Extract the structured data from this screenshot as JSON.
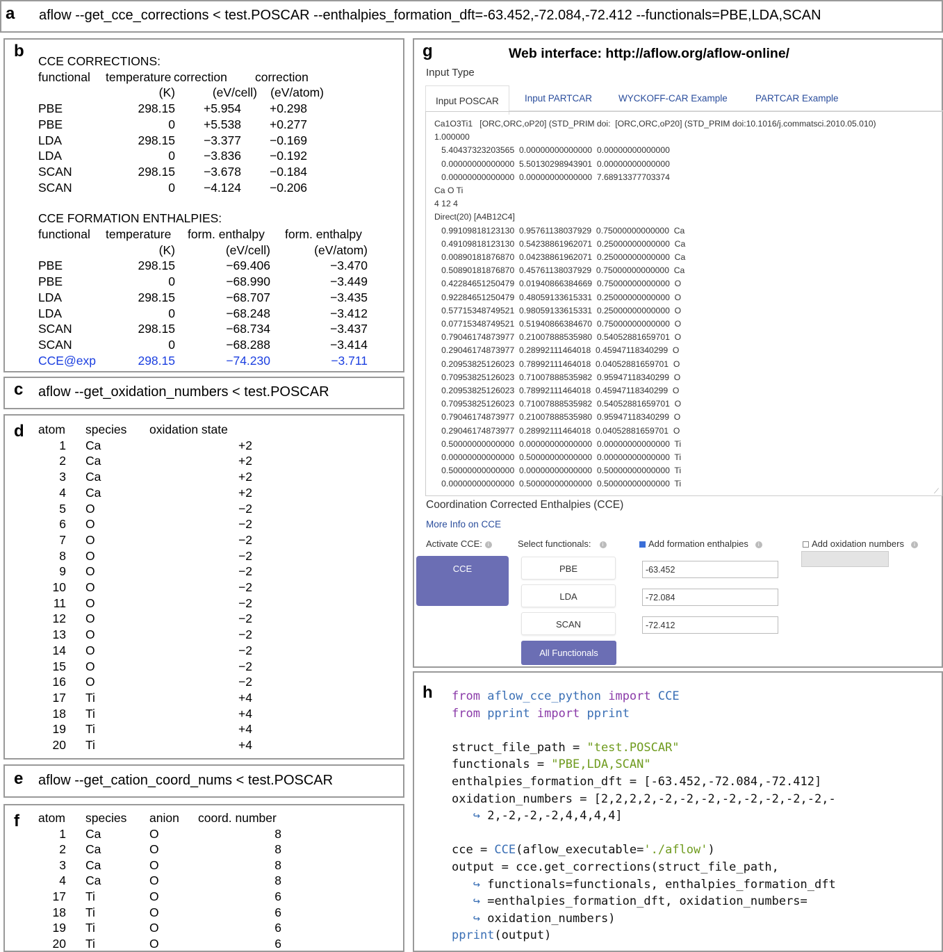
{
  "panels": {
    "a": {
      "label": "a",
      "command": "aflow --get_cce_corrections < test.POSCAR  --enthalpies_formation_dft=-63.452,-72.084,-72.412 --functionals=PBE,LDA,SCAN"
    },
    "b": {
      "label": "b",
      "corrections_title": "CCE CORRECTIONS:",
      "corrections_headers": [
        "functional",
        "temperature",
        "correction",
        "correction"
      ],
      "corrections_units": [
        "",
        "(K)",
        "(eV/cell)",
        "(eV/atom)"
      ],
      "corrections_rows": [
        [
          "PBE",
          "298.15",
          "+5.954",
          "+0.298"
        ],
        [
          "PBE",
          "0",
          "+5.538",
          "+0.277"
        ],
        [
          "LDA",
          "298.15",
          "−3.377",
          "−0.169"
        ],
        [
          "LDA",
          "0",
          "−3.836",
          "−0.192"
        ],
        [
          "SCAN",
          "298.15",
          "−3.678",
          "−0.184"
        ],
        [
          "SCAN",
          "0",
          "−4.124",
          "−0.206"
        ]
      ],
      "enthalpies_title": "CCE FORMATION ENTHALPIES:",
      "enthalpies_headers": [
        "functional",
        "temperature",
        "form. enthalpy",
        "form. enthalpy"
      ],
      "enthalpies_units": [
        "",
        "(K)",
        "(eV/cell)",
        "(eV/atom)"
      ],
      "enthalpies_rows": [
        [
          "PBE",
          "298.15",
          "−69.406",
          "−3.470"
        ],
        [
          "PBE",
          "0",
          "−68.990",
          "−3.449"
        ],
        [
          "LDA",
          "298.15",
          "−68.707",
          "−3.435"
        ],
        [
          "LDA",
          "0",
          "−68.248",
          "−3.412"
        ],
        [
          "SCAN",
          "298.15",
          "−68.734",
          "−3.437"
        ],
        [
          "SCAN",
          "0",
          "−68.288",
          "−3.414"
        ],
        [
          "CCE@exp",
          "298.15",
          "−74.230",
          "−3.711"
        ]
      ],
      "highlight_color": "#1b3fe0"
    },
    "c": {
      "label": "c",
      "command": "aflow --get_oxidation_numbers < test.POSCAR"
    },
    "d": {
      "label": "d",
      "headers": [
        "atom",
        "species",
        "oxidation state"
      ],
      "rows": [
        [
          "1",
          "Ca",
          "+2"
        ],
        [
          "2",
          "Ca",
          "+2"
        ],
        [
          "3",
          "Ca",
          "+2"
        ],
        [
          "4",
          "Ca",
          "+2"
        ],
        [
          "5",
          "O",
          "−2"
        ],
        [
          "6",
          "O",
          "−2"
        ],
        [
          "7",
          "O",
          "−2"
        ],
        [
          "8",
          "O",
          "−2"
        ],
        [
          "9",
          "O",
          "−2"
        ],
        [
          "10",
          "O",
          "−2"
        ],
        [
          "11",
          "O",
          "−2"
        ],
        [
          "12",
          "O",
          "−2"
        ],
        [
          "13",
          "O",
          "−2"
        ],
        [
          "14",
          "O",
          "−2"
        ],
        [
          "15",
          "O",
          "−2"
        ],
        [
          "16",
          "O",
          "−2"
        ],
        [
          "17",
          "Ti",
          "+4"
        ],
        [
          "18",
          "Ti",
          "+4"
        ],
        [
          "19",
          "Ti",
          "+4"
        ],
        [
          "20",
          "Ti",
          "+4"
        ]
      ]
    },
    "e": {
      "label": "e",
      "command": "aflow --get_cation_coord_nums < test.POSCAR"
    },
    "f": {
      "label": "f",
      "headers": [
        "atom",
        "species",
        "anion",
        "coord. number"
      ],
      "rows": [
        [
          "1",
          "Ca",
          "O",
          "8"
        ],
        [
          "2",
          "Ca",
          "O",
          "8"
        ],
        [
          "3",
          "Ca",
          "O",
          "8"
        ],
        [
          "4",
          "Ca",
          "O",
          "8"
        ],
        [
          "17",
          "Ti",
          "O",
          "6"
        ],
        [
          "18",
          "Ti",
          "O",
          "6"
        ],
        [
          "19",
          "Ti",
          "O",
          "6"
        ],
        [
          "20",
          "Ti",
          "O",
          "6"
        ]
      ]
    },
    "g": {
      "label": "g",
      "title": "Web interface: http://aflow.org/aflow-online/",
      "input_type_label": "Input Type",
      "tabs": [
        "Input POSCAR",
        "Input PARTCAR",
        "WYCKOFF-CAR Example",
        "PARTCAR Example"
      ],
      "poscar_lines": [
        "Ca1O3Ti1   [ORC,ORC,oP20] (STD_PRIM doi:  [ORC,ORC,oP20] (STD_PRIM doi:10.1016/j.commatsci.2010.05.010)",
        "1.000000",
        "   5.40437323203565  0.00000000000000  0.00000000000000",
        "   0.00000000000000  5.50130298943901  0.00000000000000",
        "   0.00000000000000  0.00000000000000  7.68913377703374",
        "Ca O Ti",
        "4 12 4",
        "Direct(20) [A4B12C4]",
        "   0.99109818123130  0.95761138037929  0.75000000000000  Ca",
        "   0.49109818123130  0.54238861962071  0.25000000000000  Ca",
        "   0.00890181876870  0.04238861962071  0.25000000000000  Ca",
        "   0.50890181876870  0.45761138037929  0.75000000000000  Ca",
        "   0.42284651250479  0.01940866384669  0.75000000000000  O",
        "   0.92284651250479  0.48059133615331  0.25000000000000  O",
        "   0.57715348749521  0.98059133615331  0.25000000000000  O",
        "   0.07715348749521  0.51940866384670  0.75000000000000  O",
        "   0.79046174873977  0.21007888535980  0.54052881659701  O",
        "   0.29046174873977  0.28992111464018  0.45947118340299  O",
        "   0.20953825126023  0.78992111464018  0.04052881659701  O",
        "   0.70953825126023  0.71007888535982  0.95947118340299  O",
        "   0.20953825126023  0.78992111464018  0.45947118340299  O",
        "   0.70953825126023  0.71007888535982  0.54052881659701  O",
        "   0.79046174873977  0.21007888535980  0.95947118340299  O",
        "   0.29046174873977  0.28992111464018  0.04052881659701  O",
        "   0.50000000000000  0.00000000000000  0.00000000000000  Ti",
        "   0.00000000000000  0.50000000000000  0.00000000000000  Ti",
        "   0.50000000000000  0.00000000000000  0.50000000000000  Ti",
        "   0.00000000000000  0.50000000000000  0.50000000000000  Ti"
      ],
      "cce_heading": "Coordination Corrected Enthalpies (CCE)",
      "more_info_link": "More Info on CCE",
      "activate_label": "Activate CCE:",
      "select_functionals_label": "Select functionals:",
      "add_formation_label": "Add formation enthalpies",
      "add_oxidation_label": "Add oxidation numbers",
      "add_formation_checked": true,
      "add_oxidation_checked": false,
      "cce_button": "CCE",
      "functional_buttons": [
        "PBE",
        "LDA",
        "SCAN"
      ],
      "enthalpy_inputs": [
        "-63.452",
        "-72.084",
        "-72.412"
      ],
      "all_functionals_button": "All Functionals",
      "accent_color": "#6b6eb4",
      "link_color": "#2a4d9c"
    },
    "h": {
      "label": "h",
      "code_lines": [
        [
          [
            "kw",
            "from"
          ],
          [
            "t",
            " "
          ],
          [
            "mod",
            "aflow_cce_python"
          ],
          [
            "t",
            " "
          ],
          [
            "kw",
            "import"
          ],
          [
            "t",
            " "
          ],
          [
            "mod",
            "CCE"
          ]
        ],
        [
          [
            "kw",
            "from"
          ],
          [
            "t",
            " "
          ],
          [
            "mod",
            "pprint"
          ],
          [
            "t",
            " "
          ],
          [
            "kw",
            "import"
          ],
          [
            "t",
            " "
          ],
          [
            "mod",
            "pprint"
          ]
        ],
        [],
        [
          [
            "t",
            "struct_file_path = "
          ],
          [
            "str",
            "\"test.POSCAR\""
          ]
        ],
        [
          [
            "t",
            "functionals = "
          ],
          [
            "str",
            "\"PBE,LDA,SCAN\""
          ]
        ],
        [
          [
            "t",
            "enthalpies_formation_dft = [-63.452,-72.084,-72.412]"
          ]
        ],
        [
          [
            "t",
            "oxidation_numbers = [2,2,2,2,-2,-2,-2,-2,-2,-2,-2,-2,-"
          ]
        ],
        [
          [
            "t",
            "   "
          ],
          [
            "arr",
            "↪"
          ],
          [
            "t",
            " 2,-2,-2,-2,4,4,4,4]"
          ]
        ],
        [],
        [
          [
            "t",
            "cce = "
          ],
          [
            "mod",
            "CCE"
          ],
          [
            "t",
            "(aflow_executable="
          ],
          [
            "str",
            "'./aflow'"
          ],
          [
            "t",
            ")"
          ]
        ],
        [
          [
            "t",
            "output = cce.get_corrections(struct_file_path,"
          ]
        ],
        [
          [
            "t",
            "   "
          ],
          [
            "arr",
            "↪"
          ],
          [
            "t",
            " functionals=functionals, enthalpies_formation_dft"
          ]
        ],
        [
          [
            "t",
            "   "
          ],
          [
            "arr",
            "↪"
          ],
          [
            "t",
            " =enthalpies_formation_dft, oxidation_numbers="
          ]
        ],
        [
          [
            "t",
            "   "
          ],
          [
            "arr",
            "↪"
          ],
          [
            "t",
            " oxidation_numbers)"
          ]
        ],
        [
          [
            "mod",
            "pprint"
          ],
          [
            "t",
            "(output)"
          ]
        ]
      ]
    }
  }
}
